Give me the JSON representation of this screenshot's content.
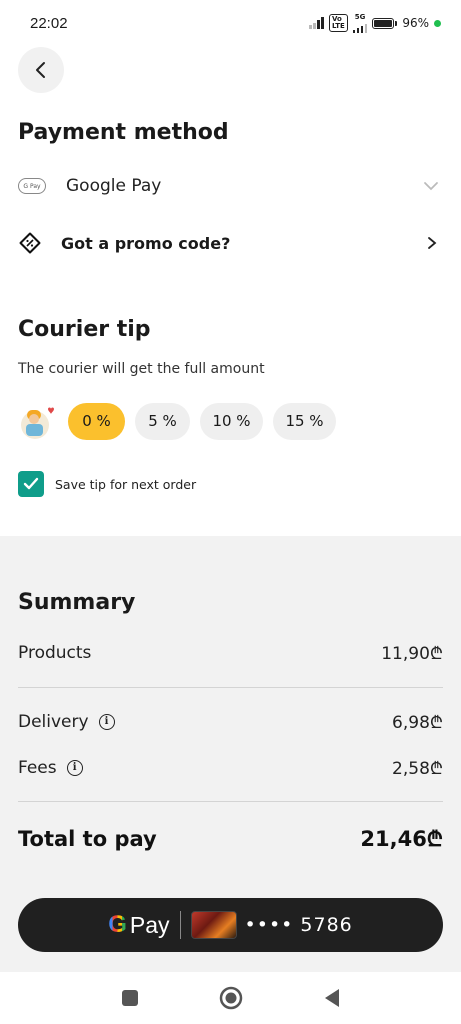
{
  "status": {
    "time": "22:02",
    "battery": "96%",
    "network_label": "5G"
  },
  "header": {
    "back_icon": "chevron-left-icon"
  },
  "payment": {
    "title": "Payment method",
    "method_name": "Google Pay",
    "method_badge": "G Pay",
    "promo_label": "Got a promo code?"
  },
  "tip": {
    "title": "Courier tip",
    "subtitle": "The courier will get the full amount",
    "options": [
      "0 %",
      "5 %",
      "10 %",
      "15 %"
    ],
    "selected": "0 %",
    "save_label": "Save tip for next order",
    "save_checked": true
  },
  "summary": {
    "title": "Summary",
    "products_label": "Products",
    "products_value": "11,90₾",
    "delivery_label": "Delivery",
    "delivery_value": "6,98₾",
    "fees_label": "Fees",
    "fees_value": "2,58₾",
    "total_label": "Total to pay",
    "total_value": "21,46₾"
  },
  "pay_button": {
    "brand_g": "G",
    "brand_text": "Pay",
    "card_masked": "•••• 5786"
  },
  "colors": {
    "accent_yellow": "#fbc02d",
    "checkbox_teal": "#0f9d8a",
    "button_dark": "#202020",
    "summary_bg": "#f2f2f2"
  }
}
